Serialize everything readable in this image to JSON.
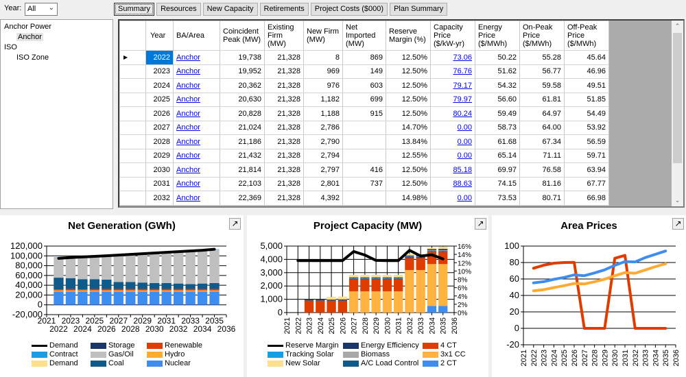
{
  "toolbar": {
    "year_label": "Year:",
    "year_value": "All",
    "tabs": [
      {
        "label": "Summary",
        "active": true
      },
      {
        "label": "Resources",
        "active": false
      },
      {
        "label": "New Capacity",
        "active": false
      },
      {
        "label": "Retirements",
        "active": false
      },
      {
        "label": "Project Costs ($000)",
        "active": false
      },
      {
        "label": "Plan Summary",
        "active": false
      }
    ]
  },
  "tree": {
    "items": [
      {
        "label": "Anchor Power",
        "level": 0,
        "selected": false
      },
      {
        "label": "Anchor",
        "level": 1,
        "selected": true
      },
      {
        "label": "ISO",
        "level": 0,
        "selected": false
      },
      {
        "label": "ISO Zone",
        "level": 1,
        "selected": false
      }
    ]
  },
  "grid": {
    "columns": [
      "Year",
      "BA/Area",
      "Coincident Peak (MW)",
      "Existing Firm (MW)",
      "New Firm (MW)",
      "Net Imported (MW)",
      "Reserve Margin (%)",
      "Capacity Price ($/kW-yr)",
      "Energy Price ($/MWh)",
      "On-Peak Price ($/MWh)",
      "Off-Peak Price ($/MWh)"
    ],
    "current_row_indicator": "▶",
    "rows": [
      {
        "year": "2022",
        "ba": "Anchor",
        "peak": "19,738",
        "existing": "21,328",
        "new_firm": "8",
        "net_imported": "869",
        "reserve": "12.50%",
        "cap_price": "73.06",
        "energy": "50.22",
        "onpeak": "55.28",
        "offpeak": "45.64"
      },
      {
        "year": "2023",
        "ba": "Anchor",
        "peak": "19,952",
        "existing": "21,328",
        "new_firm": "969",
        "net_imported": "149",
        "reserve": "12.50%",
        "cap_price": "76.76",
        "energy": "51.62",
        "onpeak": "56.77",
        "offpeak": "46.96"
      },
      {
        "year": "2024",
        "ba": "Anchor",
        "peak": "20,362",
        "existing": "21,328",
        "new_firm": "976",
        "net_imported": "603",
        "reserve": "12.50%",
        "cap_price": "79.17",
        "energy": "54.32",
        "onpeak": "59.58",
        "offpeak": "49.51"
      },
      {
        "year": "2025",
        "ba": "Anchor",
        "peak": "20,630",
        "existing": "21,328",
        "new_firm": "1,182",
        "net_imported": "699",
        "reserve": "12.50%",
        "cap_price": "79.97",
        "energy": "56.60",
        "onpeak": "61.81",
        "offpeak": "51.85"
      },
      {
        "year": "2026",
        "ba": "Anchor",
        "peak": "20,828",
        "existing": "21,328",
        "new_firm": "1,188",
        "net_imported": "915",
        "reserve": "12.50%",
        "cap_price": "80.24",
        "energy": "59.49",
        "onpeak": "64.97",
        "offpeak": "54.49"
      },
      {
        "year": "2027",
        "ba": "Anchor",
        "peak": "21,024",
        "existing": "21,328",
        "new_firm": "2,786",
        "net_imported": "",
        "reserve": "14.70%",
        "cap_price": "0.00",
        "energy": "58.73",
        "onpeak": "64.00",
        "offpeak": "53.92"
      },
      {
        "year": "2028",
        "ba": "Anchor",
        "peak": "21,186",
        "existing": "21,328",
        "new_firm": "2,790",
        "net_imported": "",
        "reserve": "13.84%",
        "cap_price": "0.00",
        "energy": "61.68",
        "onpeak": "67.34",
        "offpeak": "56.59"
      },
      {
        "year": "2029",
        "ba": "Anchor",
        "peak": "21,432",
        "existing": "21,328",
        "new_firm": "2,794",
        "net_imported": "",
        "reserve": "12.55%",
        "cap_price": "0.00",
        "energy": "65.14",
        "onpeak": "71.11",
        "offpeak": "59.71"
      },
      {
        "year": "2030",
        "ba": "Anchor",
        "peak": "21,814",
        "existing": "21,328",
        "new_firm": "2,797",
        "net_imported": "416",
        "reserve": "12.50%",
        "cap_price": "85.18",
        "energy": "69.97",
        "onpeak": "76.58",
        "offpeak": "63.94"
      },
      {
        "year": "2031",
        "ba": "Anchor",
        "peak": "22,103",
        "existing": "21,328",
        "new_firm": "2,801",
        "net_imported": "737",
        "reserve": "12.50%",
        "cap_price": "88.63",
        "energy": "74.15",
        "onpeak": "81.16",
        "offpeak": "67.77"
      },
      {
        "year": "2032",
        "ba": "Anchor",
        "peak": "22,369",
        "existing": "21,328",
        "new_firm": "4,392",
        "net_imported": "",
        "reserve": "14.98%",
        "cap_price": "0.00",
        "energy": "73.53",
        "onpeak": "80.71",
        "offpeak": "66.98"
      }
    ]
  },
  "chart_data": [
    {
      "type": "bar",
      "stacked": true,
      "title": "Net Generation (GWh)",
      "xlabel": "",
      "ylabel": "",
      "ylim": [
        -20000,
        120000
      ],
      "yticks": [
        "120,000",
        "100,000",
        "80,000",
        "60,000",
        "40,000",
        "20,000",
        "0",
        "-20,000"
      ],
      "xlim": [
        2021,
        2036
      ],
      "xticks": [
        "2021",
        "2022",
        "2023",
        "2024",
        "2025",
        "2026",
        "2027",
        "2028",
        "2029",
        "2030",
        "2031",
        "2032",
        "2033",
        "2034",
        "2035",
        "2036"
      ],
      "grid": true,
      "legend_position": "bottom",
      "legend": [
        "Demand",
        "Contract",
        "Demand",
        "Storage",
        "Gas/Oil",
        "Coal",
        "Renewable",
        "Hydro",
        "Nuclear"
      ],
      "categories": [
        2022,
        2023,
        2024,
        2025,
        2026,
        2027,
        2028,
        2029,
        2030,
        2031,
        2032,
        2033,
        2034,
        2035
      ],
      "series": [
        {
          "name": "Nuclear",
          "color": "#3d8ef0",
          "values": [
            27000,
            27000,
            27000,
            27000,
            27000,
            27000,
            27000,
            27000,
            27000,
            27000,
            27000,
            27000,
            27000,
            27000
          ]
        },
        {
          "name": "Hydro",
          "color": "#ffaa33",
          "values": [
            2500,
            2500,
            2500,
            2500,
            2500,
            2500,
            2500,
            2500,
            2500,
            2500,
            2500,
            2500,
            2500,
            2500
          ]
        },
        {
          "name": "Renewable",
          "color": "#e03c00",
          "values": [
            2000,
            3000,
            2000,
            3000,
            3000,
            3000,
            3000,
            3000,
            3000,
            3000,
            3000,
            3000,
            3000,
            3000
          ]
        },
        {
          "name": "Coal",
          "color": "#0e5a8a",
          "values": [
            24000,
            22000,
            21000,
            20000,
            19000,
            14000,
            14000,
            13000,
            12000,
            12000,
            11000,
            10000,
            11000,
            12000
          ]
        },
        {
          "name": "Gas/Oil",
          "color": "#c0c0c0",
          "values": [
            41500,
            42500,
            45500,
            45500,
            47500,
            55500,
            56500,
            58500,
            61500,
            62500,
            64500,
            66500,
            67500,
            68500
          ]
        },
        {
          "name": "Contract",
          "color": "#1a9ee0",
          "values": [
            500,
            0,
            0,
            0,
            0,
            0,
            0,
            500,
            500,
            500,
            0,
            0,
            0,
            500
          ]
        }
      ],
      "lines": [
        {
          "name": "Demand",
          "color": "#000000",
          "values": [
            95000,
            96500,
            97800,
            99000,
            100300,
            101700,
            103000,
            104400,
            105800,
            107200,
            108600,
            110000,
            111500,
            113500
          ]
        }
      ]
    },
    {
      "type": "bar",
      "stacked": true,
      "title": "Project Capacity (MW)",
      "ylim": [
        0,
        5000
      ],
      "yticks": [
        "5,000",
        "4,000",
        "3,000",
        "2,000",
        "1,000",
        "0"
      ],
      "y2lim": [
        0,
        16
      ],
      "y2ticks": [
        "16%",
        "14%",
        "12%",
        "10%",
        "8%",
        "6%",
        "4%",
        "2%",
        "0%"
      ],
      "xlim": [
        2021,
        2036
      ],
      "xticks": [
        "2021",
        "2022",
        "2023",
        "2024",
        "2025",
        "2026",
        "2027",
        "2028",
        "2029",
        "2030",
        "2031",
        "2032",
        "2033",
        "2034",
        "2035",
        "2036"
      ],
      "grid": true,
      "legend_position": "bottom",
      "legend": [
        "Reserve Margin",
        "Tracking Solar",
        "New Solar",
        "Energy Efficiency",
        "Biomass",
        "A/C Load Control",
        "4 CT",
        "3x1 CC",
        "2 CT"
      ],
      "categories": [
        2022,
        2023,
        2024,
        2025,
        2026,
        2027,
        2028,
        2029,
        2030,
        2031,
        2032,
        2033,
        2034,
        2035
      ],
      "series": [
        {
          "name": "2 CT",
          "color": "#3d8ef0",
          "values": [
            0,
            0,
            0,
            0,
            0,
            0,
            0,
            0,
            0,
            0,
            0,
            0,
            500,
            500
          ]
        },
        {
          "name": "3x1 CC",
          "color": "#ffb340",
          "values": [
            0,
            0,
            0,
            0,
            0,
            1600,
            1600,
            1600,
            1600,
            1600,
            3200,
            3200,
            3150,
            3150
          ]
        },
        {
          "name": "4 CT",
          "color": "#e03c00",
          "values": [
            0,
            900,
            900,
            900,
            900,
            900,
            900,
            900,
            900,
            900,
            900,
            900,
            900,
            900
          ]
        },
        {
          "name": "A/C Load Control",
          "color": "#0e5a8a",
          "values": [
            0,
            40,
            40,
            40,
            40,
            60,
            60,
            60,
            60,
            60,
            80,
            80,
            80,
            80
          ]
        },
        {
          "name": "Biomass",
          "color": "#a8a8a8",
          "values": [
            0,
            0,
            0,
            0,
            0,
            30,
            30,
            30,
            30,
            30,
            30,
            30,
            60,
            60
          ]
        },
        {
          "name": "Energy Efficiency",
          "color": "#1a3568",
          "values": [
            0,
            40,
            40,
            40,
            50,
            60,
            60,
            60,
            60,
            60,
            80,
            80,
            80,
            90
          ]
        },
        {
          "name": "Tracking Solar",
          "color": "#1a9ee0",
          "values": [
            0,
            0,
            0,
            0,
            0,
            0,
            0,
            0,
            0,
            0,
            0,
            0,
            0,
            20
          ]
        },
        {
          "name": "New Solar",
          "color": "#ffe08a",
          "values": [
            0,
            0,
            0,
            200,
            210,
            190,
            190,
            190,
            190,
            190,
            120,
            0,
            100,
            160
          ]
        }
      ],
      "lines": [
        {
          "name": "Reserve Margin",
          "axis": "y2",
          "color": "#000000",
          "values": [
            12.5,
            12.5,
            12.5,
            12.5,
            12.5,
            14.7,
            13.84,
            12.55,
            12.5,
            12.5,
            14.98,
            13.6,
            13.9,
            12.9
          ]
        }
      ]
    },
    {
      "type": "line",
      "title": "Area Prices",
      "ylim": [
        -20,
        100
      ],
      "yticks": [
        "100",
        "80",
        "60",
        "40",
        "20",
        "0",
        "-20"
      ],
      "xlim": [
        2021,
        2036
      ],
      "xticks": [
        "2021",
        "2022",
        "2023",
        "2024",
        "2025",
        "2026",
        "2027",
        "2028",
        "2029",
        "2030",
        "2031",
        "2032",
        "2033",
        "2034",
        "2035",
        "2036"
      ],
      "grid": true,
      "categories": [
        2022,
        2023,
        2024,
        2025,
        2026,
        2027,
        2028,
        2029,
        2030,
        2031,
        2032,
        2033,
        2034,
        2035
      ],
      "series": [
        {
          "name": "Capacity Price",
          "color": "#e03c00",
          "values": [
            73.06,
            76.76,
            79.17,
            79.97,
            80.24,
            0,
            0,
            0,
            85.18,
            88.63,
            0,
            0,
            0,
            0
          ]
        },
        {
          "name": "On-Peak Price",
          "color": "#3d8ef0",
          "values": [
            55.28,
            56.77,
            59.58,
            61.81,
            64.97,
            64.0,
            67.34,
            71.11,
            76.58,
            81.16,
            80.71,
            86,
            90,
            94
          ]
        },
        {
          "name": "Off-Peak Price",
          "color": "#ffaa33",
          "values": [
            45.64,
            46.96,
            49.51,
            51.85,
            54.49,
            53.92,
            56.59,
            59.71,
            63.94,
            67.77,
            66.98,
            71,
            75,
            78.5
          ]
        }
      ]
    }
  ]
}
